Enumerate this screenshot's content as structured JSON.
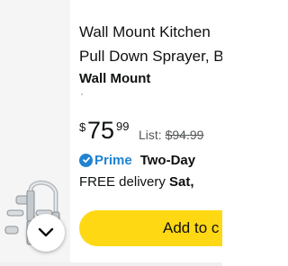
{
  "product": {
    "title_line1": "Wall Mount Kitchen",
    "title_line2": "Pull Down Sprayer, B",
    "brand": "Wall Mount",
    "price": {
      "currency": "$",
      "whole": "75",
      "fraction": "99",
      "list_label": "List: ",
      "list_price": "$94.99"
    },
    "prime": {
      "label": "Prime",
      "speed": "Two-Day"
    },
    "delivery": {
      "prefix": "FREE delivery ",
      "day": "Sat,"
    },
    "add_to_cart_label": "Add to c"
  },
  "icons": {
    "expand": "chevron-down-icon",
    "prime_check": "check-icon"
  },
  "colors": {
    "button": "#ffd814",
    "prime_blue": "#1f83d2",
    "list_gray": "#565959",
    "image_bg": "#f5f5f5"
  }
}
